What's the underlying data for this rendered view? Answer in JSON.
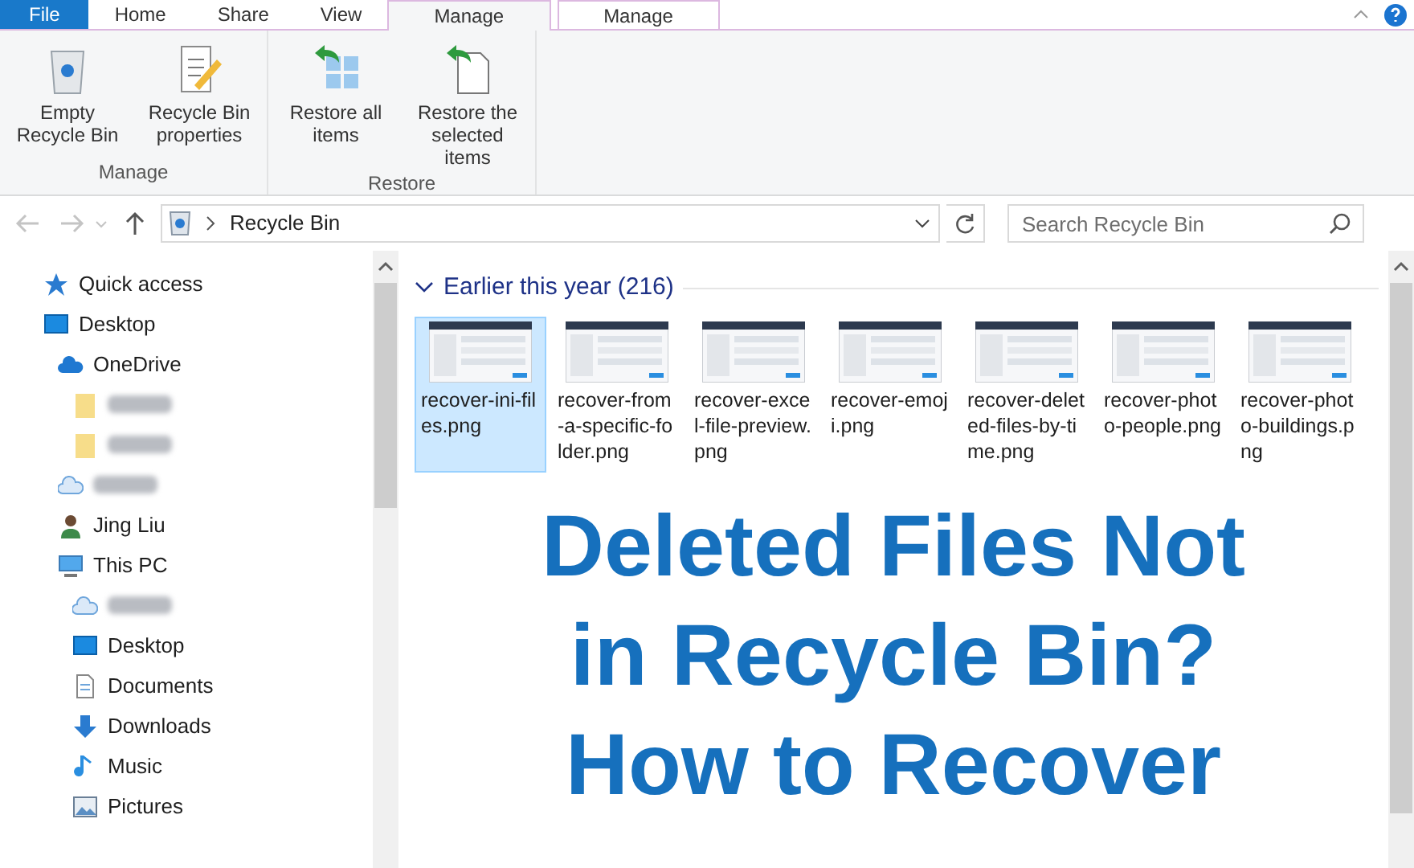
{
  "tabs": [
    {
      "label": "File",
      "kind": "file",
      "selected": false
    },
    {
      "label": "Home",
      "kind": "plain",
      "selected": false
    },
    {
      "label": "Share",
      "kind": "plain",
      "selected": false
    },
    {
      "label": "View",
      "kind": "plain",
      "selected": false
    },
    {
      "label": "Manage",
      "kind": "context",
      "selected": true
    },
    {
      "label": "Manage",
      "kind": "context",
      "selected": false
    }
  ],
  "ribbon": {
    "groups": [
      {
        "label": "Manage",
        "buttons": [
          {
            "label": "Empty Recycle Bin",
            "kind": "bin"
          },
          {
            "label": "Recycle Bin properties",
            "kind": "properties"
          }
        ]
      },
      {
        "label": "Restore",
        "buttons": [
          {
            "label": "Restore all items",
            "kind": "restore-all"
          },
          {
            "label": "Restore the selected items",
            "kind": "restore-selected"
          }
        ]
      }
    ]
  },
  "address_bar": {
    "path": "Recycle Bin"
  },
  "search": {
    "placeholder": "Search Recycle Bin"
  },
  "sidebar": {
    "items": [
      {
        "label": "Quick access",
        "kind": "star"
      },
      {
        "label": "Desktop",
        "kind": "monitor",
        "children": [
          {
            "label": "OneDrive",
            "kind": "cloud",
            "children": [
              {
                "kind": "folder"
              },
              {
                "kind": "folder"
              }
            ]
          },
          {
            "kind": "cloud-outline"
          },
          {
            "label": "Jing Liu",
            "kind": "user"
          },
          {
            "label": "This PC",
            "kind": "pc",
            "children": [
              {
                "kind": "cloud-outline"
              },
              {
                "label": "Desktop",
                "kind": "monitor"
              },
              {
                "label": "Documents",
                "kind": "document"
              },
              {
                "label": "Downloads",
                "kind": "download"
              },
              {
                "label": "Music",
                "kind": "music"
              },
              {
                "label": "Pictures",
                "kind": "pictures"
              }
            ]
          }
        ]
      }
    ]
  },
  "group": {
    "title": "Earlier this year (216)",
    "expanded": true
  },
  "files": [
    {
      "name": "recover-ini-files.png",
      "selected": true
    },
    {
      "name": "recover-from-a-specific-folder.png",
      "selected": false
    },
    {
      "name": "recover-excel-file-preview.png",
      "selected": false
    },
    {
      "name": "recover-emoji.png",
      "selected": false
    },
    {
      "name": "recover-deleted-files-by-time.png",
      "selected": false
    },
    {
      "name": "recover-photo-people.png",
      "selected": false
    },
    {
      "name": "recover-photo-buildings.png",
      "selected": false
    }
  ],
  "overlay_title": [
    "Deleted Files Not",
    "in Recycle Bin?",
    "How to Recover"
  ]
}
